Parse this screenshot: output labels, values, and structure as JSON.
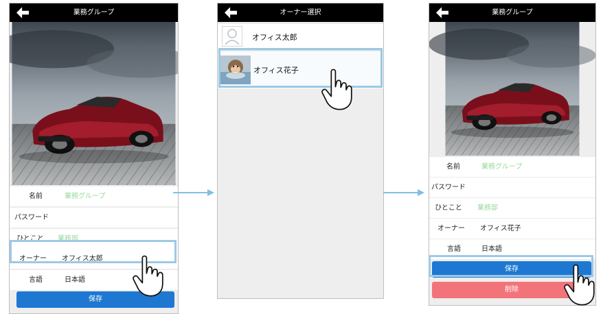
{
  "screen1": {
    "title": "業務グループ",
    "fields": [
      {
        "label": "名前",
        "value": "業務グループ",
        "placeholder": true
      },
      {
        "label": "パスワード",
        "value": "",
        "placeholder": false
      },
      {
        "label": "ひとこと",
        "value": "業務部",
        "placeholder": true
      },
      {
        "label": "オーナー",
        "value": "オフィス太郎",
        "placeholder": false
      },
      {
        "label": "言語",
        "value": "日本語",
        "placeholder": false
      }
    ],
    "save_label": "保存"
  },
  "screen2": {
    "title": "オーナー選択",
    "owners": [
      {
        "name": "オフィス太郎",
        "avatar": "default-avatar-icon"
      },
      {
        "name": "オフィス花子",
        "avatar": "monkey-onsen-avatar"
      }
    ]
  },
  "screen3": {
    "title": "業務グループ",
    "fields": [
      {
        "label": "名前",
        "value": "業務グループ",
        "placeholder": true
      },
      {
        "label": "パスワード",
        "value": "",
        "placeholder": false
      },
      {
        "label": "ひとこと",
        "value": "業務部",
        "placeholder": true
      },
      {
        "label": "オーナー",
        "value": "オフィス花子",
        "placeholder": false
      },
      {
        "label": "言語",
        "value": "日本語",
        "placeholder": false
      }
    ],
    "save_label": "保存",
    "delete_label": "削除"
  },
  "colors": {
    "topbar": "#000000",
    "highlight": "#9cc9e6",
    "save": "#1e78d2",
    "delete": "#f2747a",
    "placeholder_text": "#9ad89a",
    "flow_arrow": "#7fbfe6"
  }
}
